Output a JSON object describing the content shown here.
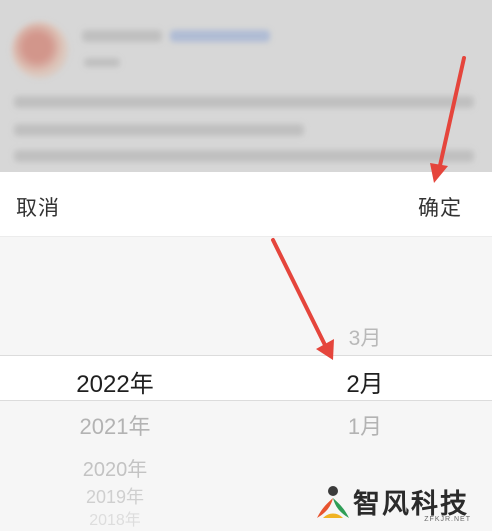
{
  "picker": {
    "cancel_label": "取消",
    "confirm_label": "确定",
    "years": {
      "above": "",
      "selected": "2022年",
      "below": [
        "2021年",
        "2020年",
        "2019年",
        "2018年"
      ]
    },
    "months": {
      "above": "3月",
      "selected": "2月",
      "below": [
        "1月"
      ]
    }
  },
  "watermark": {
    "brand": "智风科技",
    "domain": "ZFKJR.NET"
  },
  "colors": {
    "arrow": "#e5453c",
    "text_selected": "#1f1f1f",
    "text_faded": "#b3b3b3",
    "header_bg": "#ffffff",
    "sheet_bg": "#f6f6f6"
  }
}
